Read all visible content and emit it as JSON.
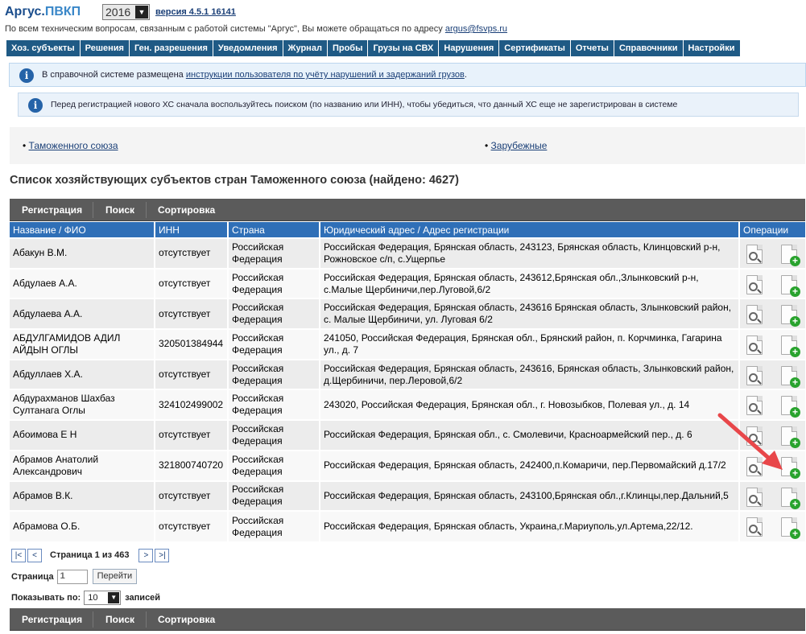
{
  "header": {
    "logo_main": "Аргус.",
    "logo_accent": "ПВКП",
    "year": "2016",
    "version": "версия 4.5.1 16141",
    "support_text": "По всем техническим вопросам, связанным с работой системы \"Аргус\", Вы можете обращаться по адресу",
    "support_email": "argus@fsvps.ru"
  },
  "nav": [
    "Хоз. субъекты",
    "Решения",
    "Ген. разрешения",
    "Уведомления",
    "Журнал",
    "Пробы",
    "Грузы на СВХ",
    "Нарушения",
    "Сертификаты",
    "Отчеты",
    "Справочники",
    "Настройки"
  ],
  "notices": {
    "first_prefix": "В справочной системе размещена",
    "first_link": "инструкции пользователя по учёту нарушений и задержаний грузов",
    "first_suffix": ".",
    "second": "Перед регистрацией нового ХС сначала воспользуйтесь поиском (по названию или ИНН), чтобы убедиться, что данный ХС еще не зарегистрирован в системе"
  },
  "subject_tabs": {
    "customs_union": "Таможенного союза",
    "foreign": "Зарубежные"
  },
  "list_title": "Список хозяйствующих субъектов стран Таможенного союза (найдено: 4627)",
  "toolbar": {
    "register": "Регистрация",
    "search": "Поиск",
    "sort": "Сортировка"
  },
  "table": {
    "columns": [
      "Название / ФИО",
      "ИНН",
      "Страна",
      "Юридический адрес / Адрес регистрации",
      "Операции"
    ],
    "rows": [
      {
        "name": "Абакун В.М.",
        "inn": "отсутствует",
        "country": "Российская Федерация",
        "address": "Российская Федерация, Брянская область, 243123, Брянская область, Клинцовский р-н, Рожновское с/п, с.Ущерпье"
      },
      {
        "name": "Абдулаев А.А.",
        "inn": "отсутствует",
        "country": "Российская Федерация",
        "address": "Российская Федерация, Брянская область, 243612,Брянская обл.,Злынковский р-н, с.Малые Щербиничи,пер.Луговой,6/2"
      },
      {
        "name": "Абдулаева А.А.",
        "inn": "отсутствует",
        "country": "Российская Федерация",
        "address": "Российская Федерация, Брянская область, 243616 Брянская область, Злынковский район, с. Малые Щербиничи, ул. Луговая 6/2"
      },
      {
        "name": "АБДУЛГАМИДОВ АДИЛ АЙДЫН ОГЛЫ",
        "inn": "320501384944",
        "country": "Российская Федерация",
        "address": "241050, Российская Федерация, Брянская обл., Брянский район, п. Корчминка, Гагарина ул., д. 7"
      },
      {
        "name": "Абдуллаев Х.А.",
        "inn": "отсутствует",
        "country": "Российская Федерация",
        "address": "Российская Федерация, Брянская область, 243616, Брянская область, Злынковский район, д.Щербиничи, пер.Леровой,6/2"
      },
      {
        "name": "Абдурахманов Шахбаз Султанага Оглы",
        "inn": "324102499002",
        "country": "Российская Федерация",
        "address": "243020, Российская Федерация, Брянская обл., г. Новозыбков, Полевая ул., д. 14"
      },
      {
        "name": "Абоимова Е Н",
        "inn": "отсутствует",
        "country": "Российская Федерация",
        "address": "Российская Федерация, Брянская обл., с. Смолевичи, Красноармейский пер., д. 6"
      },
      {
        "name": "Абрамов Анатолий Александрович",
        "inn": "321800740720",
        "country": "Российская Федерация",
        "address": "Российская Федерация, Брянская область, 242400,п.Комаричи, пер.Первомайский д.17/2"
      },
      {
        "name": "Абрамов В.К.",
        "inn": "отсутствует",
        "country": "Российская Федерация",
        "address": "Российская Федерация, Брянская область, 243100,Брянская обл.,г.Клинцы,пер.Дальний,5"
      },
      {
        "name": "Абрамова О.Б.",
        "inn": "отсутствует",
        "country": "Российская Федерация",
        "address": "Российская Федерация, Брянская область, Украина,г.Мариуполь,ул.Артема,22/12."
      }
    ]
  },
  "pager": {
    "first": "|<",
    "prev": "<",
    "info": "Страница 1 из 463",
    "next": ">",
    "last": ">|",
    "page_label": "Страница",
    "page_value": "1",
    "go": "Перейти",
    "show_label": "Показывать по:",
    "per_page": "10",
    "records": "записей"
  },
  "colors": {
    "nav_bg": "#1f5a85",
    "table_header": "#2f6fb7",
    "toolbar_bg": "#5b5b5b",
    "arrow": "#e8474a"
  },
  "icons": {
    "view": "view-magnifier-icon",
    "add": "add-document-icon",
    "info": "info-icon"
  }
}
